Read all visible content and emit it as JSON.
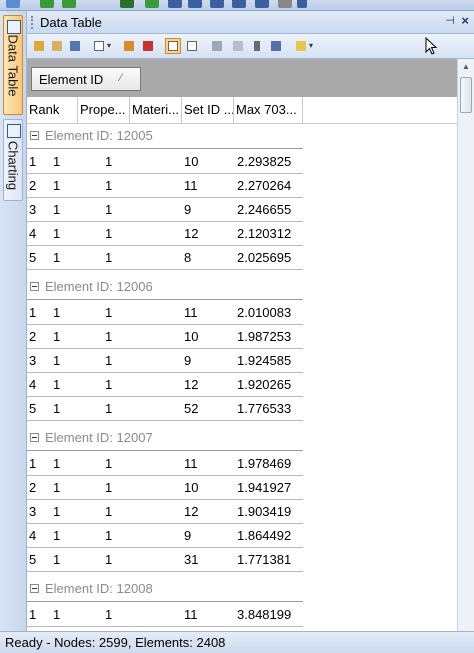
{
  "panel": {
    "title": "Data Table",
    "pin_glyph": "⊣",
    "close_glyph": "×"
  },
  "side_tabs": [
    {
      "label": "Data Table",
      "icon": "table-icon"
    },
    {
      "label": "Charting",
      "icon": "chart-icon"
    }
  ],
  "groupby": {
    "chip_label": "Element ID",
    "sort_glyph": "⁄"
  },
  "columns": [
    "Rank",
    "Prope...",
    "Materi...",
    "Set ID ...",
    "Max 703..."
  ],
  "groups": [
    {
      "label": "Element ID: 12005",
      "rows": [
        [
          "1",
          "1",
          "1",
          "10",
          "2.293825"
        ],
        [
          "2",
          "1",
          "1",
          "11",
          "2.270264"
        ],
        [
          "3",
          "1",
          "1",
          "9",
          "2.246655"
        ],
        [
          "4",
          "1",
          "1",
          "12",
          "2.120312"
        ],
        [
          "5",
          "1",
          "1",
          "8",
          "2.025695"
        ]
      ]
    },
    {
      "label": "Element ID: 12006",
      "rows": [
        [
          "1",
          "1",
          "1",
          "11",
          "2.010083"
        ],
        [
          "2",
          "1",
          "1",
          "10",
          "1.987253"
        ],
        [
          "3",
          "1",
          "1",
          "9",
          "1.924585"
        ],
        [
          "4",
          "1",
          "1",
          "12",
          "1.920265"
        ],
        [
          "5",
          "1",
          "1",
          "52",
          "1.776533"
        ]
      ]
    },
    {
      "label": "Element ID: 12007",
      "rows": [
        [
          "1",
          "1",
          "1",
          "11",
          "1.978469"
        ],
        [
          "2",
          "1",
          "1",
          "10",
          "1.941927"
        ],
        [
          "3",
          "1",
          "1",
          "12",
          "1.903419"
        ],
        [
          "4",
          "1",
          "1",
          "9",
          "1.864492"
        ],
        [
          "5",
          "1",
          "1",
          "31",
          "1.771381"
        ]
      ]
    },
    {
      "label": "Element ID: 12008",
      "rows": [
        [
          "1",
          "1",
          "1",
          "11",
          "3.848199"
        ]
      ]
    }
  ],
  "status": {
    "text": "Ready - Nodes: 2599,  Elements: 2408"
  },
  "colors": {
    "active_tab": "#f7c87a",
    "group_text": "#8a8a8a",
    "groupby_bg": "#a9a9a9"
  }
}
